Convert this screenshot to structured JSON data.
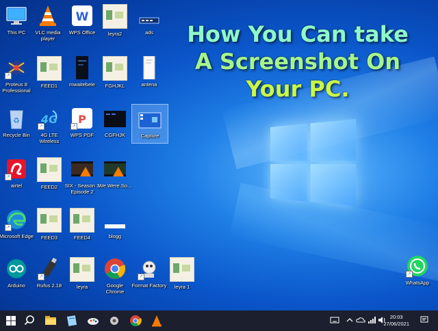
{
  "headline": {
    "line1": "How You Can take",
    "line2": "A Screenshot On",
    "line3": "Your PC."
  },
  "desktop_icons": {
    "this_pc": "This PC",
    "vlc": "VLC media player",
    "wps_office": "WPS Office",
    "leyra2": "leyra2",
    "ads": "ads",
    "proteus": "Proteus 8 Professional",
    "feed1": "FEED1",
    "mwaitebele": "mwaitebele",
    "fghjkl": "FGHJKL",
    "antena": "antena",
    "recycle_bin": "Recycle Bin",
    "lte": "4G LTE Wireless",
    "wps_pdf": "WPS PDF",
    "cgfhjk": "CGFHJK",
    "capture": "Capture",
    "airtel": "airtel",
    "feed2": "FEED2",
    "six": "SIX - Season 1 Episode 2",
    "wewereso": "We.Were.So...",
    "edge": "Microsoft Edge",
    "feed3": "FEED3",
    "feed4": "FEED4",
    "blogg": "blogg",
    "arduino": "Arduino",
    "rufus": "Rufus 2.18",
    "leyra": "leyra",
    "chrome": "Google Chrome",
    "format_factory": "Format Factory",
    "leyra1": "leyra 1",
    "whatsapp": "WhatsApp"
  },
  "taskbar": {
    "time": "20:03",
    "date": "27/06/2021",
    "apps": [
      "start-icon",
      "search-icon",
      "file-explorer-icon",
      "notepad-icon",
      "paint-icon",
      "tools-icon",
      "chrome-icon",
      "vlc-icon"
    ]
  },
  "colors": {
    "taskbar": "#1b1f2e",
    "headline_line1": "#8ff7c8",
    "headline_line2": "#a6f58c",
    "headline_line3": "#c9f74a"
  }
}
